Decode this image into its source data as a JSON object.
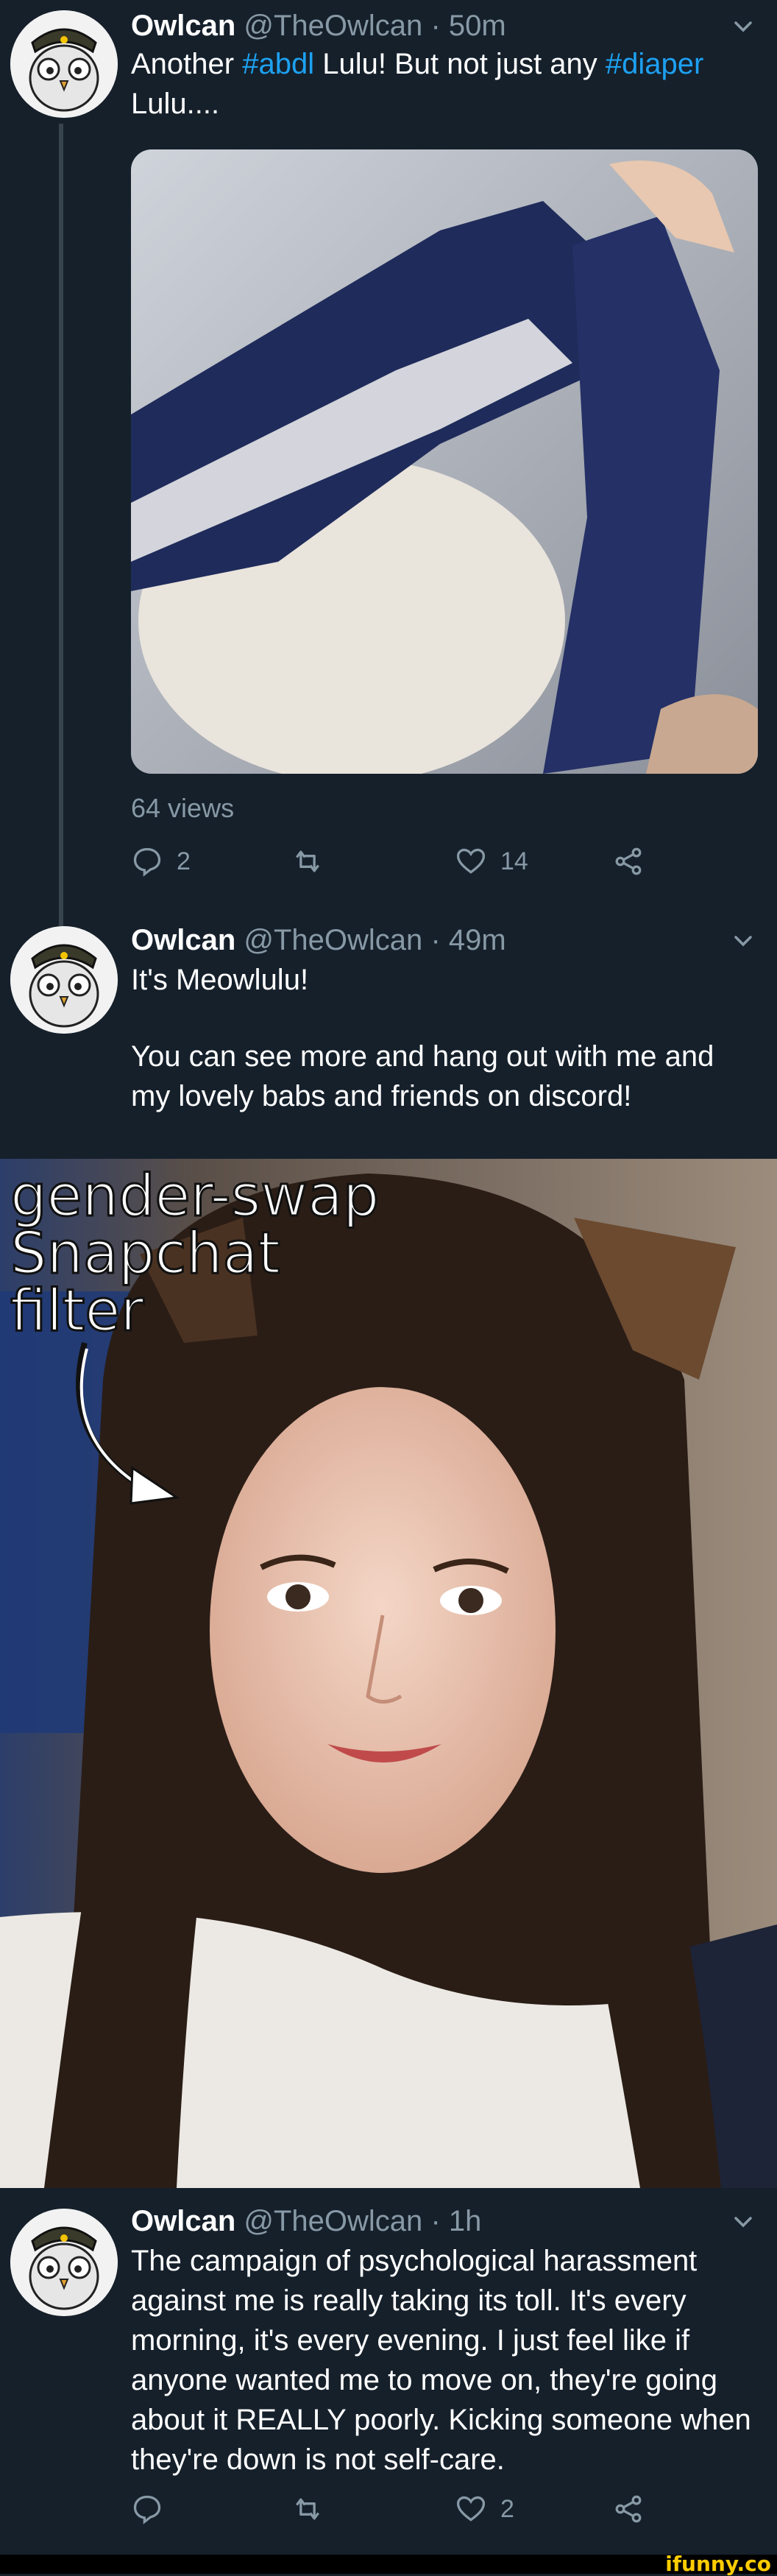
{
  "tweets": [
    {
      "name": "Owlcan",
      "handle": "@TheOwlcan",
      "time": "50m",
      "text_parts": [
        "Another ",
        "#abdl",
        " Lulu! But not just any ",
        "#diaper",
        " Lulu...."
      ],
      "views": "64 views",
      "reply_count": "2",
      "retweet_count": "",
      "like_count": "14"
    },
    {
      "name": "Owlcan",
      "handle": "@TheOwlcan",
      "time": "49m",
      "line1": "It's Meowlulu!",
      "line2": "You can see more and hang out with me and my lovely babs and friends on discord!"
    },
    {
      "name": "Owlcan",
      "handle": "@TheOwlcan",
      "time": "1h",
      "text": "The campaign of psychological harassment against me is really taking its toll. It's every morning, it's every evening. I just feel like if anyone wanted me to move on, they're going about it REALLY poorly. Kicking someone when they're down is not self-care.",
      "reply_count": "",
      "retweet_count": "",
      "like_count": "2"
    }
  ],
  "overlay": {
    "line1": "gender-swap",
    "line2": "Snapchat",
    "line3": "filter"
  },
  "watermark": "ifunny.co",
  "colors": {
    "background": "#15202b",
    "muted": "#8899a6",
    "hashtag": "#1da1f2"
  }
}
